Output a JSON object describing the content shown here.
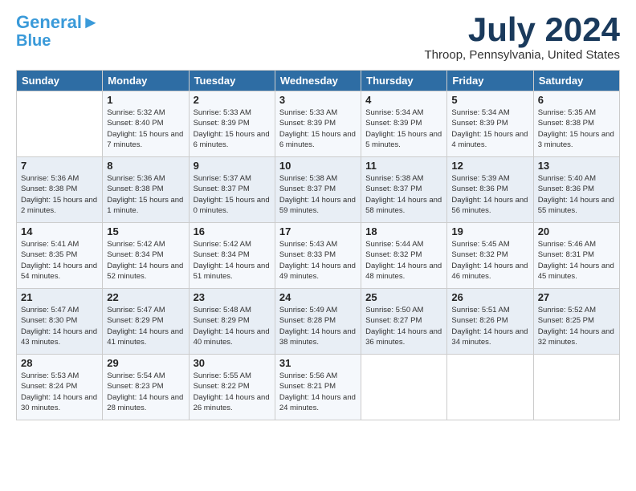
{
  "header": {
    "logo_line1": "General",
    "logo_line2": "Blue",
    "month": "July 2024",
    "location": "Throop, Pennsylvania, United States"
  },
  "weekdays": [
    "Sunday",
    "Monday",
    "Tuesday",
    "Wednesday",
    "Thursday",
    "Friday",
    "Saturday"
  ],
  "weeks": [
    [
      {
        "day": "",
        "sunrise": "",
        "sunset": "",
        "daylight": ""
      },
      {
        "day": "1",
        "sunrise": "Sunrise: 5:32 AM",
        "sunset": "Sunset: 8:40 PM",
        "daylight": "Daylight: 15 hours and 7 minutes."
      },
      {
        "day": "2",
        "sunrise": "Sunrise: 5:33 AM",
        "sunset": "Sunset: 8:39 PM",
        "daylight": "Daylight: 15 hours and 6 minutes."
      },
      {
        "day": "3",
        "sunrise": "Sunrise: 5:33 AM",
        "sunset": "Sunset: 8:39 PM",
        "daylight": "Daylight: 15 hours and 6 minutes."
      },
      {
        "day": "4",
        "sunrise": "Sunrise: 5:34 AM",
        "sunset": "Sunset: 8:39 PM",
        "daylight": "Daylight: 15 hours and 5 minutes."
      },
      {
        "day": "5",
        "sunrise": "Sunrise: 5:34 AM",
        "sunset": "Sunset: 8:39 PM",
        "daylight": "Daylight: 15 hours and 4 minutes."
      },
      {
        "day": "6",
        "sunrise": "Sunrise: 5:35 AM",
        "sunset": "Sunset: 8:38 PM",
        "daylight": "Daylight: 15 hours and 3 minutes."
      }
    ],
    [
      {
        "day": "7",
        "sunrise": "Sunrise: 5:36 AM",
        "sunset": "Sunset: 8:38 PM",
        "daylight": "Daylight: 15 hours and 2 minutes."
      },
      {
        "day": "8",
        "sunrise": "Sunrise: 5:36 AM",
        "sunset": "Sunset: 8:38 PM",
        "daylight": "Daylight: 15 hours and 1 minute."
      },
      {
        "day": "9",
        "sunrise": "Sunrise: 5:37 AM",
        "sunset": "Sunset: 8:37 PM",
        "daylight": "Daylight: 15 hours and 0 minutes."
      },
      {
        "day": "10",
        "sunrise": "Sunrise: 5:38 AM",
        "sunset": "Sunset: 8:37 PM",
        "daylight": "Daylight: 14 hours and 59 minutes."
      },
      {
        "day": "11",
        "sunrise": "Sunrise: 5:38 AM",
        "sunset": "Sunset: 8:37 PM",
        "daylight": "Daylight: 14 hours and 58 minutes."
      },
      {
        "day": "12",
        "sunrise": "Sunrise: 5:39 AM",
        "sunset": "Sunset: 8:36 PM",
        "daylight": "Daylight: 14 hours and 56 minutes."
      },
      {
        "day": "13",
        "sunrise": "Sunrise: 5:40 AM",
        "sunset": "Sunset: 8:36 PM",
        "daylight": "Daylight: 14 hours and 55 minutes."
      }
    ],
    [
      {
        "day": "14",
        "sunrise": "Sunrise: 5:41 AM",
        "sunset": "Sunset: 8:35 PM",
        "daylight": "Daylight: 14 hours and 54 minutes."
      },
      {
        "day": "15",
        "sunrise": "Sunrise: 5:42 AM",
        "sunset": "Sunset: 8:34 PM",
        "daylight": "Daylight: 14 hours and 52 minutes."
      },
      {
        "day": "16",
        "sunrise": "Sunrise: 5:42 AM",
        "sunset": "Sunset: 8:34 PM",
        "daylight": "Daylight: 14 hours and 51 minutes."
      },
      {
        "day": "17",
        "sunrise": "Sunrise: 5:43 AM",
        "sunset": "Sunset: 8:33 PM",
        "daylight": "Daylight: 14 hours and 49 minutes."
      },
      {
        "day": "18",
        "sunrise": "Sunrise: 5:44 AM",
        "sunset": "Sunset: 8:32 PM",
        "daylight": "Daylight: 14 hours and 48 minutes."
      },
      {
        "day": "19",
        "sunrise": "Sunrise: 5:45 AM",
        "sunset": "Sunset: 8:32 PM",
        "daylight": "Daylight: 14 hours and 46 minutes."
      },
      {
        "day": "20",
        "sunrise": "Sunrise: 5:46 AM",
        "sunset": "Sunset: 8:31 PM",
        "daylight": "Daylight: 14 hours and 45 minutes."
      }
    ],
    [
      {
        "day": "21",
        "sunrise": "Sunrise: 5:47 AM",
        "sunset": "Sunset: 8:30 PM",
        "daylight": "Daylight: 14 hours and 43 minutes."
      },
      {
        "day": "22",
        "sunrise": "Sunrise: 5:47 AM",
        "sunset": "Sunset: 8:29 PM",
        "daylight": "Daylight: 14 hours and 41 minutes."
      },
      {
        "day": "23",
        "sunrise": "Sunrise: 5:48 AM",
        "sunset": "Sunset: 8:29 PM",
        "daylight": "Daylight: 14 hours and 40 minutes."
      },
      {
        "day": "24",
        "sunrise": "Sunrise: 5:49 AM",
        "sunset": "Sunset: 8:28 PM",
        "daylight": "Daylight: 14 hours and 38 minutes."
      },
      {
        "day": "25",
        "sunrise": "Sunrise: 5:50 AM",
        "sunset": "Sunset: 8:27 PM",
        "daylight": "Daylight: 14 hours and 36 minutes."
      },
      {
        "day": "26",
        "sunrise": "Sunrise: 5:51 AM",
        "sunset": "Sunset: 8:26 PM",
        "daylight": "Daylight: 14 hours and 34 minutes."
      },
      {
        "day": "27",
        "sunrise": "Sunrise: 5:52 AM",
        "sunset": "Sunset: 8:25 PM",
        "daylight": "Daylight: 14 hours and 32 minutes."
      }
    ],
    [
      {
        "day": "28",
        "sunrise": "Sunrise: 5:53 AM",
        "sunset": "Sunset: 8:24 PM",
        "daylight": "Daylight: 14 hours and 30 minutes."
      },
      {
        "day": "29",
        "sunrise": "Sunrise: 5:54 AM",
        "sunset": "Sunset: 8:23 PM",
        "daylight": "Daylight: 14 hours and 28 minutes."
      },
      {
        "day": "30",
        "sunrise": "Sunrise: 5:55 AM",
        "sunset": "Sunset: 8:22 PM",
        "daylight": "Daylight: 14 hours and 26 minutes."
      },
      {
        "day": "31",
        "sunrise": "Sunrise: 5:56 AM",
        "sunset": "Sunset: 8:21 PM",
        "daylight": "Daylight: 14 hours and 24 minutes."
      },
      {
        "day": "",
        "sunrise": "",
        "sunset": "",
        "daylight": ""
      },
      {
        "day": "",
        "sunrise": "",
        "sunset": "",
        "daylight": ""
      },
      {
        "day": "",
        "sunrise": "",
        "sunset": "",
        "daylight": ""
      }
    ]
  ]
}
